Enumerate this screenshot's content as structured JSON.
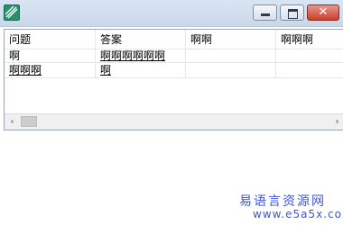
{
  "window": {
    "title": "",
    "buttons": {
      "minimize": "minimize",
      "maximize": "maximize",
      "close": "✕"
    }
  },
  "grid": {
    "columns": [
      "问题",
      "答案",
      "啊啊",
      "啊啊啊"
    ],
    "rows": [
      [
        "啊",
        "啊啊啊啊啊啊",
        "",
        ""
      ],
      [
        "啊啊啊",
        "啊",
        "",
        ""
      ]
    ],
    "scrollbar": {
      "left_arrow": "‹",
      "right_arrow": "›"
    }
  },
  "watermark": {
    "cn": "易语言资源网",
    "url": "www.e5a5x.com"
  },
  "colors": {
    "titlebar": "#d2dfee",
    "close_button": "#c9402c",
    "watermark": "#3f56d8"
  }
}
